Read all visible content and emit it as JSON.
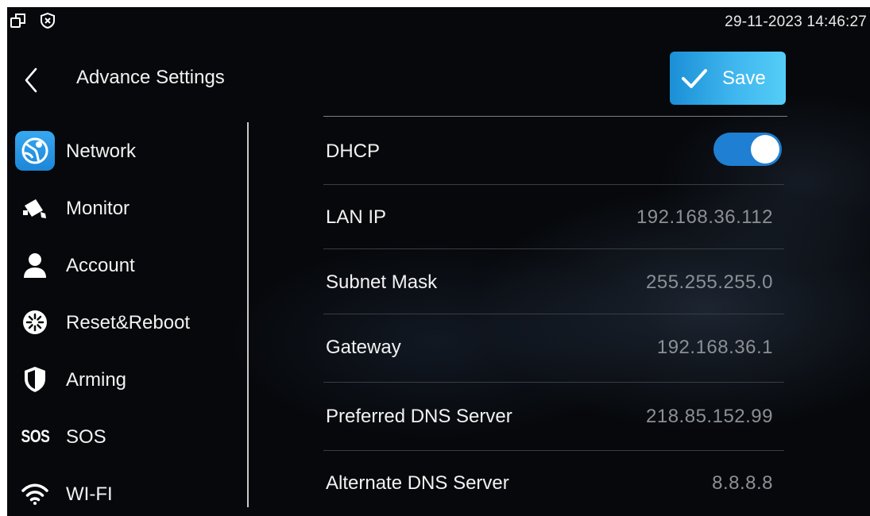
{
  "statusbar": {
    "datetime": "29-11-2023 14:46:27",
    "icons": [
      "window-icon",
      "shield-x-icon"
    ]
  },
  "header": {
    "title": "Advance Settings",
    "back_icon": "chevron-left-icon",
    "save_label": "Save",
    "save_icon": "check-icon"
  },
  "sidebar": {
    "items": [
      {
        "label": "Network",
        "icon": "network-icon",
        "active": true
      },
      {
        "label": "Monitor",
        "icon": "camera-icon"
      },
      {
        "label": "Account",
        "icon": "user-icon"
      },
      {
        "label": "Reset&Reboot",
        "icon": "reset-icon"
      },
      {
        "label": "Arming",
        "icon": "shield-icon"
      },
      {
        "label": "SOS",
        "icon": "sos-icon",
        "icon_text": "SOS"
      },
      {
        "label": "WI-FI",
        "icon": "wifi-icon"
      }
    ]
  },
  "settings": {
    "dhcp": {
      "label": "DHCP",
      "enabled": true
    },
    "rows": [
      {
        "label": "LAN IP",
        "value": "192.168.36.112"
      },
      {
        "label": "Subnet Mask",
        "value": "255.255.255.0"
      },
      {
        "label": "Gateway",
        "value": "192.168.36.1"
      },
      {
        "label": "Preferred DNS Server",
        "value": "218.85.152.99"
      },
      {
        "label": "Alternate DNS Server",
        "value": "8.8.8.8"
      }
    ]
  },
  "colors": {
    "accent": "#1f7fd2",
    "save_gradient_start": "#1b8fd6",
    "save_gradient_end": "#55cdf7",
    "background": "#06080b",
    "value_text": "#8c8f94"
  }
}
